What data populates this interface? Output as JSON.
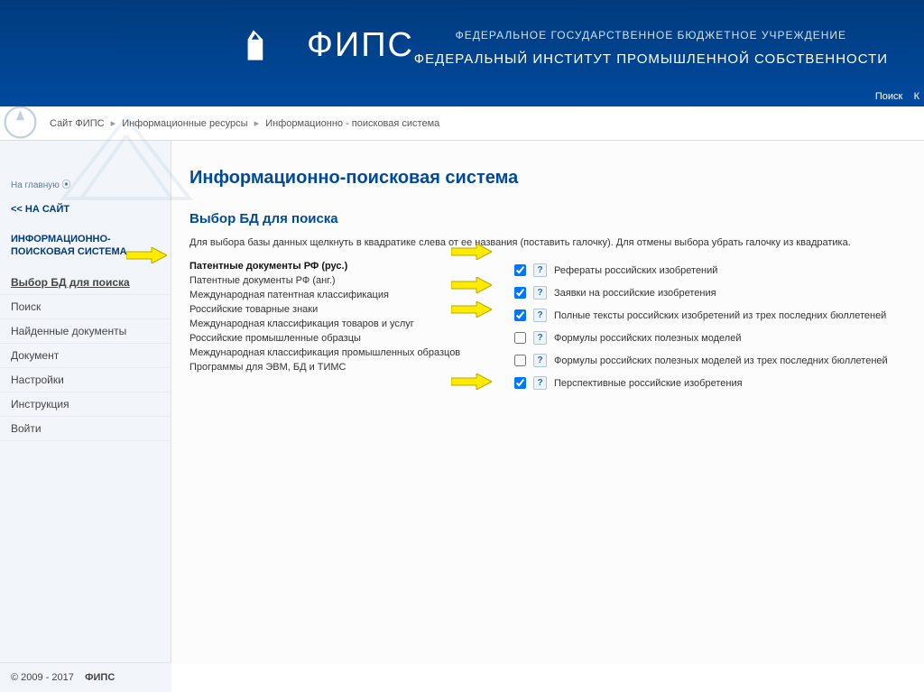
{
  "header": {
    "brand": "ФИПС",
    "subtitle1": "ФЕДЕРАЛЬНОЕ ГОСУДАРСТВЕННОЕ БЮДЖЕТНОЕ УЧРЕЖДЕНИЕ",
    "subtitle2": "ФЕДЕРАЛЬНЫЙ ИНСТИТУТ ПРОМЫШЛЕННОЙ СОБСТВЕННОСТИ",
    "link_search": "Поиск",
    "link_k": "К"
  },
  "breadcrumb": {
    "items": [
      "Сайт ФИПС",
      "Информационные ресурсы",
      "Информационно - поисковая система"
    ]
  },
  "sidebar": {
    "home": "На главную",
    "back": "<< НА САЙТ",
    "heading": "ИНФОРМАЦИОННО-ПОИСКОВАЯ СИСТЕМА",
    "items": [
      "Выбор БД для поиска",
      "Поиск",
      "Найденные документы",
      "Документ",
      "Настройки",
      "Инструкция",
      "Войти"
    ]
  },
  "content": {
    "page_title": "Информационно-поисковая система",
    "section_title": "Выбор БД для поиска",
    "intro": "Для выбора базы данных щелкнуть в квадратике слева от ее названия (поставить галочку). Для отмены выбора убрать галочку из квадратика.",
    "categories": [
      {
        "label": "Патентные документы РФ (рус.)",
        "bold": true
      },
      {
        "label": "Патентные документы РФ (анг.)",
        "bold": false
      },
      {
        "label": "Международная патентная классификация",
        "bold": false
      },
      {
        "label": "Российские товарные знаки",
        "bold": false
      },
      {
        "label": "Международная классификация товаров и услуг",
        "bold": false
      },
      {
        "label": "Российские промышленные образцы",
        "bold": false
      },
      {
        "label": "Международная классификация промышленных образцов",
        "bold": false
      },
      {
        "label": "Программы для ЭВМ, БД и ТИМС",
        "bold": false
      }
    ],
    "databases": [
      {
        "label": "Рефераты российских изобретений",
        "checked": true
      },
      {
        "label": "Заявки на российские изобретения",
        "checked": true
      },
      {
        "label": "Полные тексты российских изобретений из трех последних бюллетеней",
        "checked": true
      },
      {
        "label": "Формулы российских полезных моделей",
        "checked": false
      },
      {
        "label": "Формулы российских полезных моделей из трех последних бюллетеней",
        "checked": false
      },
      {
        "label": "Перспективные российские изобретения",
        "checked": true
      }
    ],
    "help_char": "?"
  },
  "footer": {
    "copyright": "© 2009 - 2017",
    "org": "ФИПС"
  }
}
